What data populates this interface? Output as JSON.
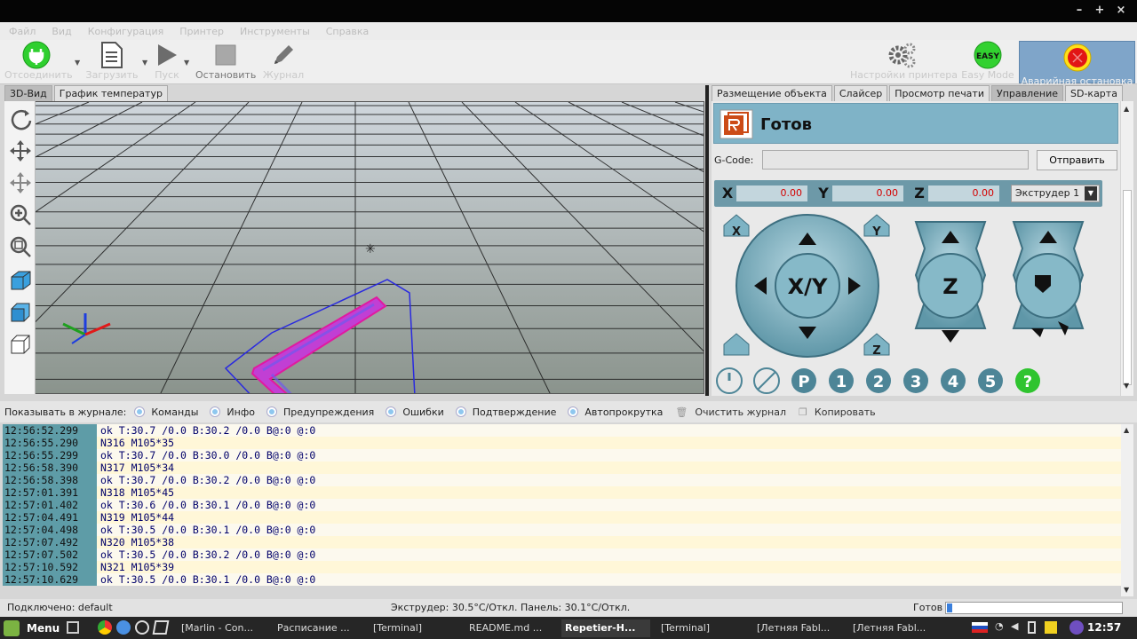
{
  "window": {
    "min": "–",
    "max": "+",
    "close": "×"
  },
  "menu": [
    "Файл",
    "Вид",
    "Конфигурация",
    "Принтер",
    "Инструменты",
    "Справка"
  ],
  "toolbar": {
    "disconnect": "Отсоединить",
    "load": "Загрузить",
    "run": "Пуск",
    "stop": "Остановить",
    "log": "Журнал",
    "printer_settings": "Настройки принтера",
    "easy_mode": "Easy Mode",
    "easy_badge": "EASY",
    "emergency_stop": "Аварийная остановка"
  },
  "left_tabs": [
    "3D-Вид",
    "График температур"
  ],
  "right_tabs": [
    "Размещение объекта",
    "Слайсер",
    "Просмотр печати",
    "Управление",
    "SD-карта"
  ],
  "control": {
    "status": "Готов",
    "gcode_label": "G-Code:",
    "gcode_value": "",
    "send": "Отправить",
    "x_label": "X",
    "x_value": "0.00",
    "y_label": "Y",
    "y_value": "0.00",
    "z_label": "Z",
    "z_value": "0.00",
    "extruder": "Экструдер 1",
    "xy_label": "X/Y",
    "z_jog_label": "Z",
    "home_x": "X",
    "home_y": "Y",
    "home_z": "Z",
    "bottom_buttons": [
      "P",
      "1",
      "2",
      "3",
      "4",
      "5",
      "?"
    ]
  },
  "logbar": {
    "label": "Показывать в журнале:",
    "filters": [
      "Команды",
      "Инфо",
      "Предупреждения",
      "Ошибки",
      "Подтверждение",
      "Автопрокрутка"
    ],
    "clear": "Очистить журнал",
    "copy": "Копировать"
  },
  "log": [
    {
      "time": "12:56:52.299",
      "msg": "ok T:30.7 /0.0 B:30.2 /0.0 B@:0 @:0"
    },
    {
      "time": "12:56:55.290",
      "msg": "N316 M105*35"
    },
    {
      "time": "12:56:55.299",
      "msg": "ok T:30.7 /0.0 B:30.0 /0.0 B@:0 @:0"
    },
    {
      "time": "12:56:58.390",
      "msg": "N317 M105*34"
    },
    {
      "time": "12:56:58.398",
      "msg": "ok T:30.7 /0.0 B:30.2 /0.0 B@:0 @:0"
    },
    {
      "time": "12:57:01.391",
      "msg": "N318 M105*45"
    },
    {
      "time": "12:57:01.402",
      "msg": "ok T:30.6 /0.0 B:30.1 /0.0 B@:0 @:0"
    },
    {
      "time": "12:57:04.491",
      "msg": "N319 M105*44"
    },
    {
      "time": "12:57:04.498",
      "msg": "ok T:30.5 /0.0 B:30.1 /0.0 B@:0 @:0"
    },
    {
      "time": "12:57:07.492",
      "msg": "N320 M105*38"
    },
    {
      "time": "12:57:07.502",
      "msg": "ok T:30.5 /0.0 B:30.2 /0.0 B@:0 @:0"
    },
    {
      "time": "12:57:10.592",
      "msg": "N321 M105*39"
    },
    {
      "time": "12:57:10.629",
      "msg": "ok T:30.5 /0.0 B:30.1 /0.0 B@:0 @:0"
    }
  ],
  "statusbar": {
    "connection": "Подключено: default",
    "temps": "Экструдер: 30.5°C/Откл. Панель: 30.1°C/Откл.",
    "state": "Готов"
  },
  "taskbar": {
    "menu": "Menu",
    "tasks": [
      {
        "label": "[Marlin - Con..."
      },
      {
        "label": "Расписание ..."
      },
      {
        "label": "[Terminal]"
      },
      {
        "label": "README.md ..."
      },
      {
        "label": "Repetier-H..."
      },
      {
        "label": "[Terminal]"
      },
      {
        "label": "[Летняя Fabl..."
      },
      {
        "label": "[Летняя Fabl..."
      }
    ],
    "clock": "12:57"
  },
  "colors": {
    "accent": "#7fa5c9",
    "teal_panel": "#7fb3c7",
    "log_time_bg": "#5e9ca7",
    "coord_value": "#d40000"
  }
}
